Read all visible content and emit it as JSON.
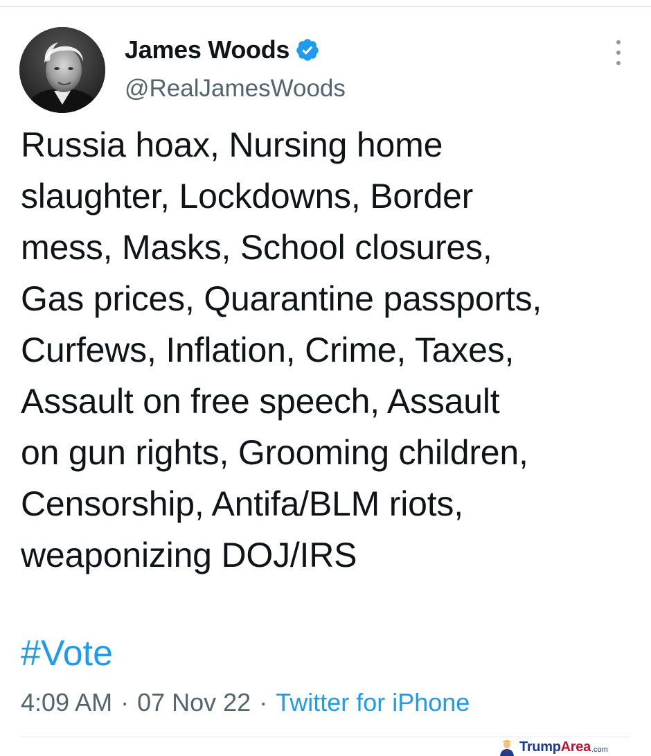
{
  "user": {
    "display_name": "James Woods",
    "handle": "@RealJamesWoods",
    "verified": true,
    "avatar_icon": "profile-photo"
  },
  "tweet": {
    "text": "Russia hoax, Nursing home\nslaughter, Lockdowns, Border\nmess, Masks, School closures,\nGas prices, Quarantine passports,\nCurfews, Inflation, Crime, Taxes,\nAssault on free speech, Assault\non gun rights, Grooming children,\nCensorship, Antifa/BLM riots,\nweaponizing DOJ/IRS",
    "hashtag": "#Vote",
    "time": "4:09 AM",
    "separator": "·",
    "date": "07 Nov 22",
    "source": "Twitter for iPhone"
  },
  "watermark": {
    "brand_main": "Trump",
    "brand_accent": "Area",
    "domain": ".com"
  },
  "colors": {
    "link": "#1d9bf0",
    "secondary_text": "#536471",
    "verified_badge": "#1d9bf0"
  }
}
